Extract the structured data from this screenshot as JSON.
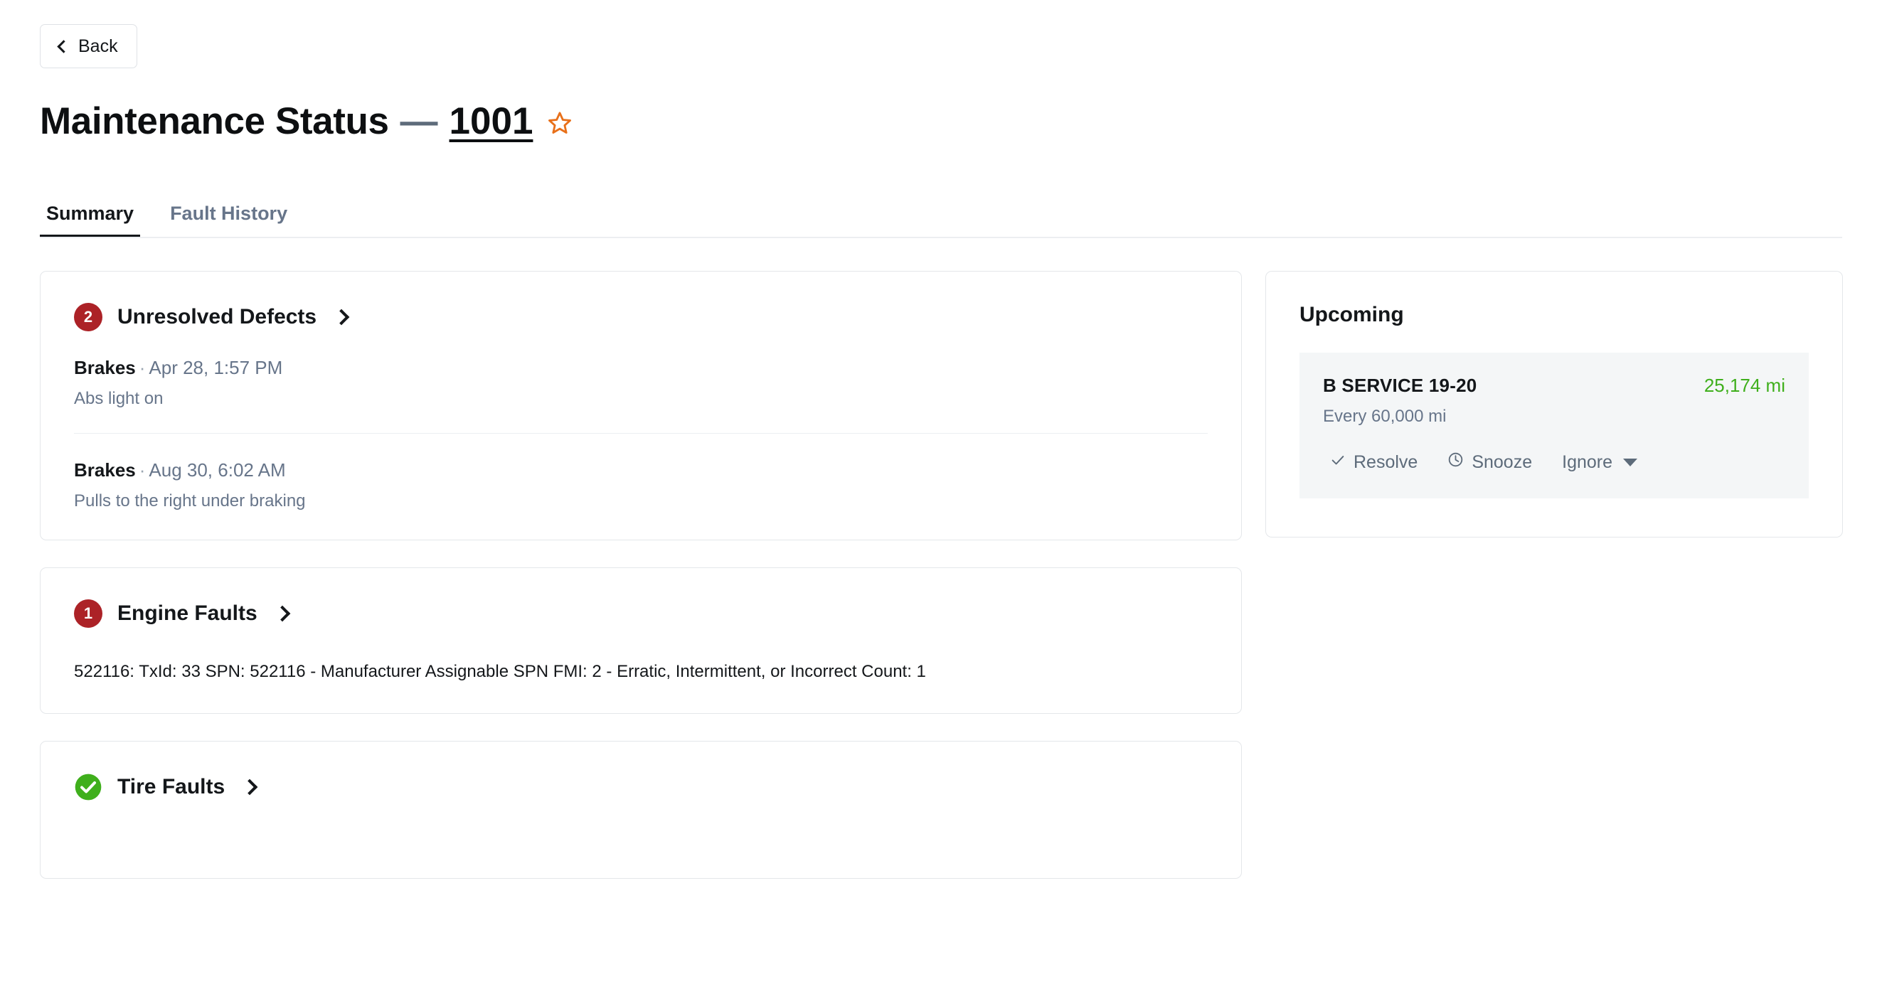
{
  "nav": {
    "back_label": "Back",
    "back_icon": "chevron-left-icon"
  },
  "header": {
    "title": "Maintenance Status",
    "dash": "—",
    "vehicle_id": "1001",
    "star_icon": "star-outline-icon",
    "star_color": "#e8701a"
  },
  "tabs": [
    {
      "label": "Summary",
      "active": true
    },
    {
      "label": "Fault History",
      "active": false
    }
  ],
  "sections": {
    "unresolved_defects": {
      "badge_count": "2",
      "badge_color": "#ac2227",
      "title": "Unresolved Defects",
      "chevron_icon": "chevron-right-icon",
      "defects": [
        {
          "category": "Brakes",
          "separator": "·",
          "timestamp": "Apr 28, 1:57 PM",
          "note": "Abs light on"
        },
        {
          "category": "Brakes",
          "separator": "·",
          "timestamp": "Aug 30, 6:02 AM",
          "note": "Pulls to the right under braking"
        }
      ]
    },
    "engine_faults": {
      "badge_count": "1",
      "badge_color": "#ac2227",
      "title": "Engine Faults",
      "chevron_icon": "chevron-right-icon",
      "fault_text": "522116: TxId: 33 SPN: 522116 - Manufacturer Assignable SPN FMI: 2 - Erratic, Intermittent, or Incorrect Count: 1"
    },
    "tire_faults": {
      "status_icon": "check-circle-icon",
      "status_color": "#3faf1c",
      "title": "Tire Faults",
      "chevron_icon": "chevron-right-icon"
    }
  },
  "upcoming": {
    "title": "Upcoming",
    "items": [
      {
        "name": "B SERVICE 19-20",
        "remaining": "25,174 mi",
        "remaining_color": "#3faf1c",
        "interval": "Every 60,000 mi",
        "actions": [
          {
            "label": "Resolve",
            "icon": "check-icon"
          },
          {
            "label": "Snooze",
            "icon": "clock-icon"
          },
          {
            "label": "Ignore",
            "icon": "caret-down-icon"
          }
        ]
      }
    ]
  }
}
